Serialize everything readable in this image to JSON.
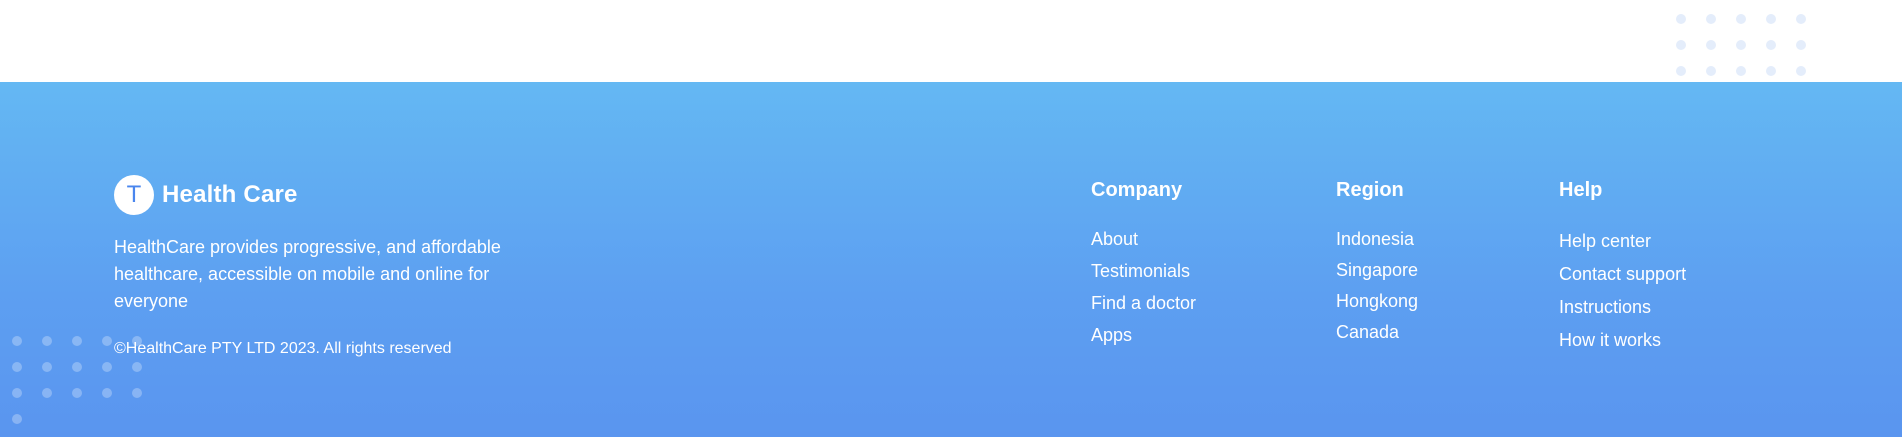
{
  "brand": {
    "logo_letter": "T",
    "name": "Health Care"
  },
  "description": "HealthCare provides progressive, and affordable healthcare, accessible on mobile and online for everyone",
  "copyright": "©HealthCare PTY LTD 2023. All rights reserved",
  "columns": {
    "company": {
      "heading": "Company",
      "links": [
        "About",
        "Testimonials",
        "Find a doctor",
        "Apps"
      ]
    },
    "region": {
      "heading": "Region",
      "links": [
        "Indonesia",
        "Singapore",
        "Hongkong",
        "Canada"
      ]
    },
    "help": {
      "heading": "Help",
      "links": [
        "Help center",
        "Contact support",
        "Instructions",
        "How it works"
      ]
    }
  },
  "colors": {
    "footer_gradient_top": "#64b8f3",
    "footer_gradient_bottom": "#5a95ef",
    "logo_text": "#4a86ee",
    "top_dots": "#e4edfb"
  },
  "icons": [
    "dot-pattern-decoration"
  ]
}
